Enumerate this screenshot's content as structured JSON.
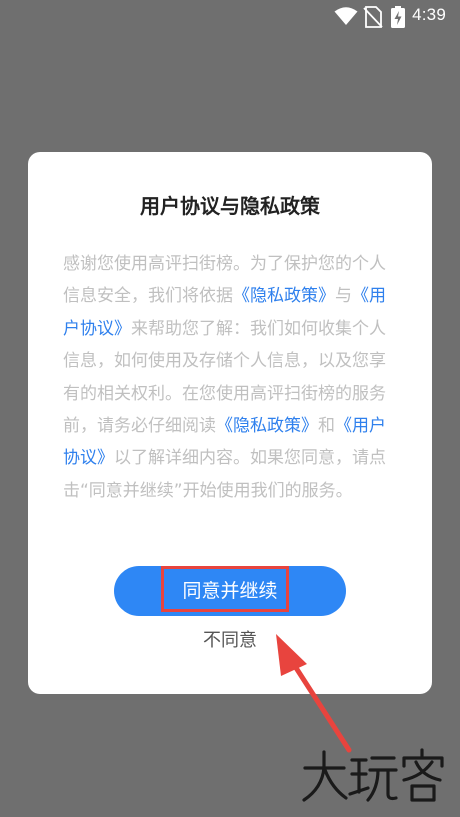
{
  "status_bar": {
    "time": "4:39",
    "icons": [
      "wifi-icon",
      "no-sim-icon",
      "battery-charging-icon"
    ]
  },
  "dialog": {
    "title": "用户协议与隐私政策",
    "body": [
      {
        "text": "感谢您使用高评扫街榜。为了保护您的个人信息安全，我们将依据",
        "link": false
      },
      {
        "text": "《隐私政策》",
        "link": true
      },
      {
        "text": "与",
        "link": false
      },
      {
        "text": "《用户协议》",
        "link": true
      },
      {
        "text": "来帮助您了解：我们如何收集个人信息，如何使用及存储个人信息，以及您享有的相关权利。在您使用高评扫街榜的服务前，请务必仔细阅读",
        "link": false
      },
      {
        "text": "《隐私政策》",
        "link": true
      },
      {
        "text": "和",
        "link": false
      },
      {
        "text": "《用户协议》",
        "link": true
      },
      {
        "text": "以了解详细内容。如果您同意，请点击“同意并继续”开始使用我们的服务。",
        "link": false
      }
    ],
    "agree_label": "同意并继续",
    "disagree_label": "不同意"
  },
  "annotation": {
    "highlight_color": "#e8443e",
    "watermark_text": "大玩客"
  },
  "colors": {
    "overlay": "#6f6f6f",
    "accent": "#2e87f5",
    "link": "#2f80ed",
    "body_text": "#c0c0c0"
  }
}
